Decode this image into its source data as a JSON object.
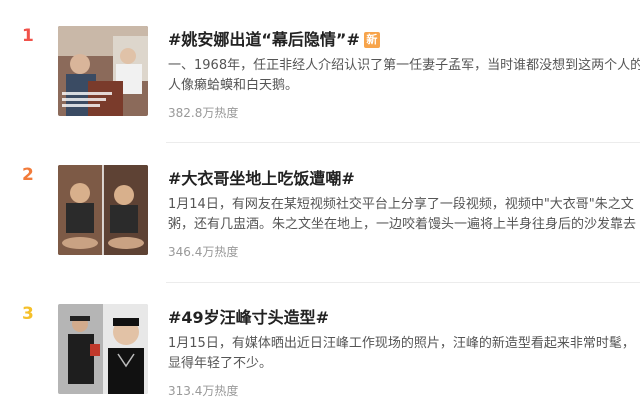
{
  "items": [
    {
      "rank": "1",
      "rank_color": "#f0524a",
      "title": "#姚安娜出道“幕后隐情”#",
      "badge": "新",
      "desc_line1": "一、1968年，任正非经人介绍认识了第一任妻子孟军，当时谁都没想到这两个人的",
      "desc_line2": "人像癞蛤蟆和白天鹅。",
      "heat": "382.8万热度"
    },
    {
      "rank": "2",
      "rank_color": "#f27b3a",
      "title": "#大衣哥坐地上吃饭遭嘲#",
      "desc_line1": "1月14日，有网友在某短视频社交平台上分享了一段视频，视频中\"大衣哥\"朱之文",
      "desc_line2": "粥，还有几盅酒。朱之文坐在地上，一边咬着馒头一遍将上半身往身后的沙发靠去",
      "heat": "346.4万热度"
    },
    {
      "rank": "3",
      "rank_color": "#f5c02a",
      "title": "#49岁汪峰寸头造型#",
      "desc_line1": "1月15日，有媒体晒出近日汪峰工作现场的照片，汪峰的新造型看起来非常时髦，",
      "desc_line2": "显得年轻了不少。",
      "heat": "313.4万热度"
    }
  ]
}
